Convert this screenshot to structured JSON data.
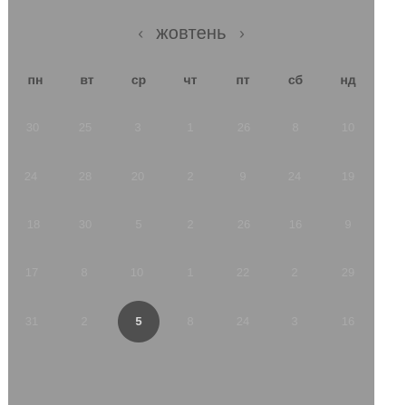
{
  "header": {
    "prev_label": "‹",
    "month_label": "жовтень",
    "next_label": "›"
  },
  "weekdays": [
    "пн",
    "вт",
    "ср",
    "чт",
    "пт",
    "сб",
    "нд"
  ],
  "weeks": [
    [
      "30",
      "25",
      "3",
      "1",
      "26",
      "8",
      "10"
    ],
    [
      "24",
      "28",
      "20",
      "2",
      "9",
      "24",
      "19"
    ],
    [
      "18",
      "30",
      "5",
      "2",
      "26",
      "16",
      "9"
    ],
    [
      "17",
      "8",
      "10",
      "1",
      "22",
      "2",
      "29"
    ],
    [
      "31",
      "2",
      "5",
      "8",
      "24",
      "3",
      "16"
    ]
  ],
  "selected_day": "5",
  "colors": {
    "panel_bg": "#999999",
    "selected_bg": "#4f4f4f",
    "selected_text": "#d7d7d7",
    "muted_text": "#aaaaaa"
  }
}
